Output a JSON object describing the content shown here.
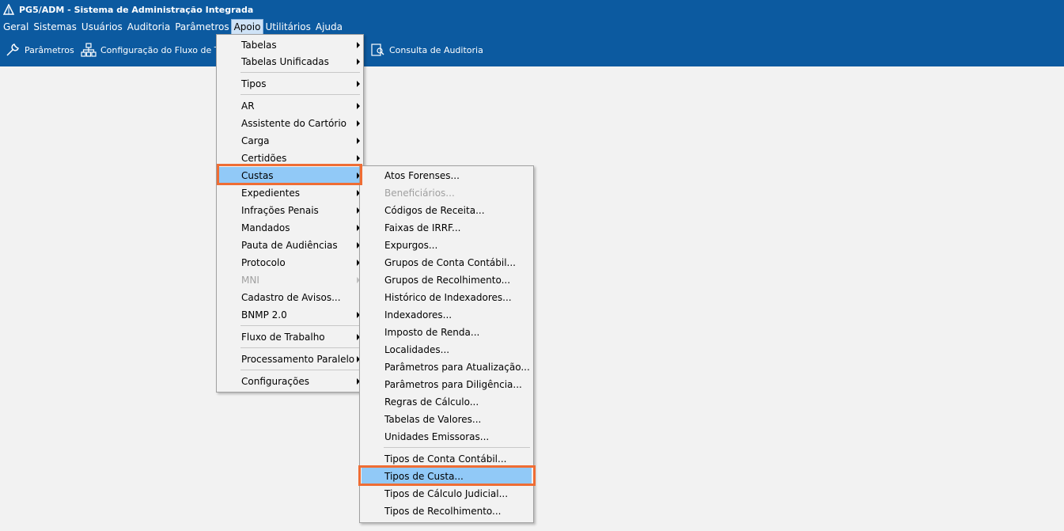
{
  "title": "PG5/ADM - Sistema de Administração Integrada",
  "menubar": [
    "Geral",
    "Sistemas",
    "Usuários",
    "Auditoria",
    "Parâmetros",
    "Apoio",
    "Utilitários",
    "Ajuda"
  ],
  "toolbar": {
    "parametros": "Parâmetros",
    "fluxo": "Configuração do Fluxo de Tra",
    "consulta": "Consulta de Auditoria"
  },
  "apoio_menu": [
    "Tabelas",
    "Tabelas Unificadas",
    "Tipos",
    "AR",
    "Assistente do Cartório",
    "Carga",
    "Certidões",
    "Custas",
    "Expedientes",
    "Infrações Penais",
    "Mandados",
    "Pauta de Audiências",
    "Protocolo",
    "MNI",
    "Cadastro de Avisos...",
    "BNMP 2.0",
    "Fluxo de Trabalho",
    "Processamento Paralelo",
    "Configurações"
  ],
  "custas_menu": [
    "Atos Forenses...",
    "Beneficiários...",
    "Códigos de Receita...",
    "Faixas de IRRF...",
    "Expurgos...",
    "Grupos de Conta Contábil...",
    "Grupos de Recolhimento...",
    "Histórico de Indexadores...",
    "Indexadores...",
    "Imposto de Renda...",
    "Localidades...",
    "Parâmetros para Atualização...",
    "Parâmetros para Diligência...",
    "Regras de Cálculo...",
    "Tabelas de Valores...",
    "Unidades Emissoras...",
    "Tipos de Conta Contábil...",
    "Tipos de Custa...",
    "Tipos de Cálculo Judicial...",
    "Tipos de Recolhimento..."
  ],
  "colors": {
    "accent": "#0c5aa0",
    "selection": "#91c9f7",
    "highlight": "#ef6d34"
  }
}
